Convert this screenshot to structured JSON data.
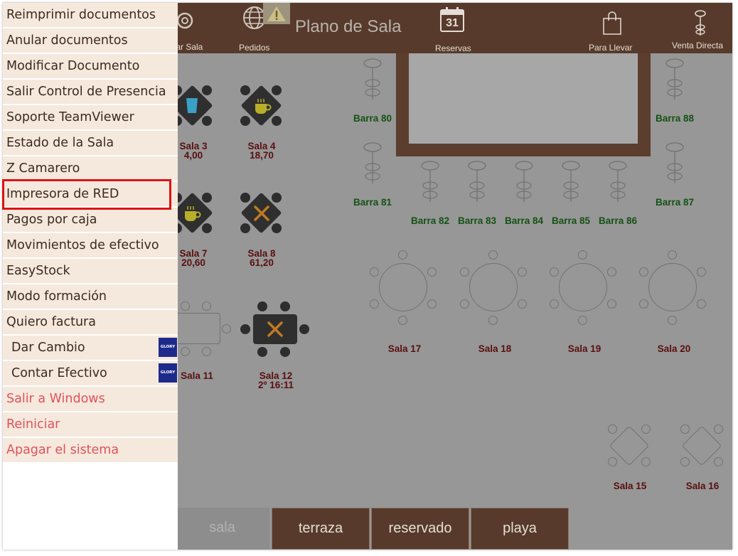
{
  "header": {
    "title": "Plano de Sala",
    "items": {
      "tomar_sala": "tar Sala",
      "pedidos": "Pedidos",
      "reservas": "Reservas",
      "calendar_day": "31",
      "para_llevar": "Para Llevar",
      "venta_directa": "Venta Directa"
    }
  },
  "menu": {
    "items": [
      {
        "label": "Reimprimir documentos"
      },
      {
        "label": "Anular documentos"
      },
      {
        "label": "Modificar Documento"
      },
      {
        "label": "Salir Control de Presencia"
      },
      {
        "label": "Soporte TeamViewer"
      },
      {
        "label": "Estado de la Sala"
      },
      {
        "label": "Z Camarero"
      },
      {
        "label": "Impresora de RED"
      },
      {
        "label": "Pagos por caja"
      },
      {
        "label": "Movimientos de efectivo"
      },
      {
        "label": "EasyStock"
      },
      {
        "label": "Modo formación"
      },
      {
        "label": "Quiero factura"
      },
      {
        "label": "Dar Cambio",
        "badge": "GLORY"
      },
      {
        "label": "Contar Efectivo",
        "badge": "GLORY"
      },
      {
        "label": "Salir a Windows"
      },
      {
        "label": "Reiniciar"
      },
      {
        "label": "Apagar el sistema"
      }
    ],
    "highlighted": "Impresora de RED"
  },
  "tables": {
    "sala3": {
      "name": "Sala 3",
      "value": "4,00"
    },
    "sala4": {
      "name": "Sala 4",
      "value": "18,70"
    },
    "sala7": {
      "name": "Sala 7",
      "value": "20,60"
    },
    "sala8": {
      "name": "Sala 8",
      "value": "61,20"
    },
    "sala11": {
      "name": "Sala 11"
    },
    "sala12": {
      "name": "Sala 12",
      "value": "2º  16:11"
    },
    "sala15": {
      "name": "Sala 15"
    },
    "sala16": {
      "name": "Sala 16"
    },
    "sala17": {
      "name": "Sala 17"
    },
    "sala18": {
      "name": "Sala 18"
    },
    "sala19": {
      "name": "Sala 19"
    },
    "sala20": {
      "name": "Sala 20"
    }
  },
  "barras": {
    "b80": "Barra 80",
    "b81": "Barra 81",
    "b82": "Barra 82",
    "b83": "Barra 83",
    "b84": "Barra 84",
    "b85": "Barra 85",
    "b86": "Barra 86",
    "b87": "Barra 87",
    "b88": "Barra 88"
  },
  "tabs": [
    {
      "label": "sala",
      "active": true
    },
    {
      "label": "terraza"
    },
    {
      "label": "reservado"
    },
    {
      "label": "playa"
    }
  ],
  "colors": {
    "topbar": "#573a2b",
    "floor": "#979797",
    "menu_bg": "#f5e8dd",
    "menu_danger": "#e0525a",
    "highlight": "#e01010",
    "barra_label": "#145214",
    "table_label": "#5a0f0f"
  },
  "icons": {
    "tomar_sala": "gear-icon",
    "pedidos": "globe-icon",
    "warning": "warning-icon",
    "reservas": "calendar-icon",
    "para_llevar": "shopping-bag-icon",
    "venta_directa": "bar-stool-icon"
  }
}
